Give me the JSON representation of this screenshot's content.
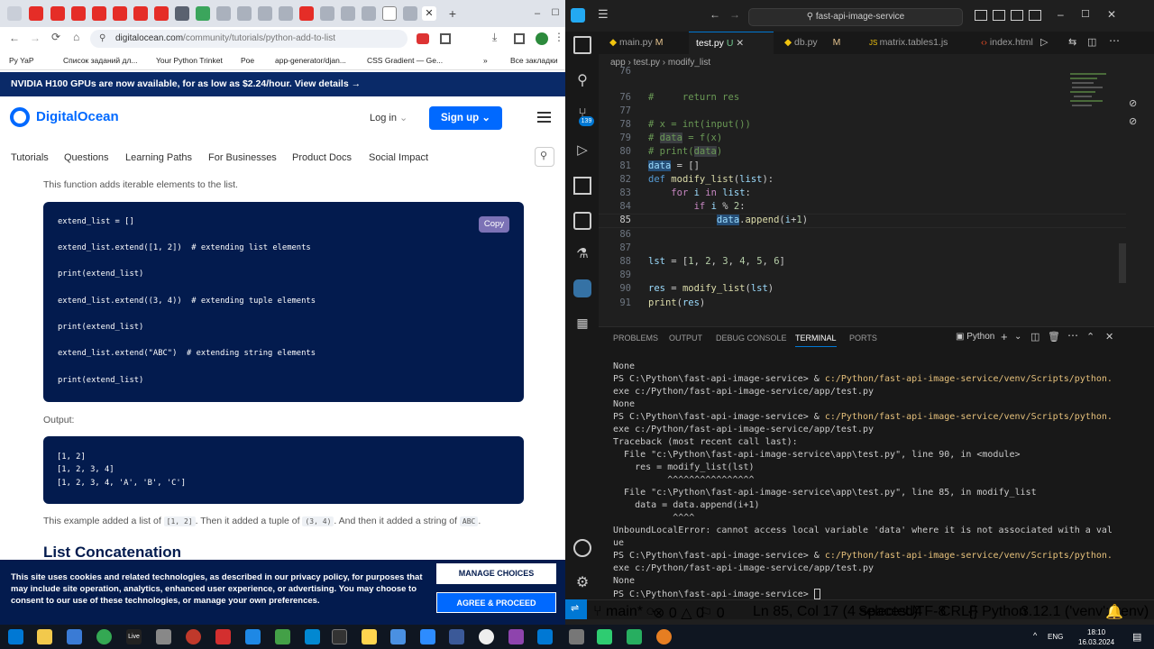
{
  "browser": {
    "url_host": "digitalocean.com",
    "url_path": "/community/tutorials/python-add-to-list",
    "bookmarks": [
      "Py YaP",
      "Список заданий дл...",
      "Your Python Trinket",
      "Poe",
      "app-generator/djan...",
      "CSS Gradient — Ge...",
      "»",
      "Все закладки"
    ],
    "banner": "NVIDIA H100 GPUs are now available, for as low as $2.24/hour. View details →",
    "logo": "DigitalOcean",
    "login": "Log in",
    "signup": "Sign up",
    "subnav": [
      "Tutorials",
      "Questions",
      "Learning Paths",
      "For Businesses",
      "Product Docs",
      "Social Impact"
    ],
    "intro": "This function adds iterable elements to the list.",
    "code_lines": [
      "extend_list = []",
      "extend_list.extend([1, 2])  # extending list elements",
      "print(extend_list)",
      "extend_list.extend((3, 4))  # extending tuple elements",
      "print(extend_list)",
      "extend_list.extend(\"ABC\")  # extending string elements",
      "print(extend_list)"
    ],
    "copy": "Copy",
    "output_label": "Output:",
    "output_lines": [
      "[1, 2]",
      "[1, 2, 3, 4]",
      "[1, 2, 3, 4, 'A', 'B', 'C']"
    ],
    "example_text": {
      "a": "This example added a list of",
      "b": "[1, 2]",
      "c": ". Then it added a tuple of",
      "d": "(3, 4)",
      "e": ". And then it added a string of",
      "f": "ABC",
      "g": "."
    },
    "heading": "List Concatenation",
    "cookie_text": "This site uses cookies and related technologies, as described in our privacy policy, for purposes that may include site operation, analytics, enhanced user experience, or advertising. You may choose to consent to our use of these technologies, or manage your own preferences.",
    "manage_choices": "MANAGE CHOICES",
    "agree": "AGREE & PROCEED"
  },
  "vscode": {
    "search": "fast-api-image-service",
    "tabs": [
      {
        "label": "main.py",
        "badge": "M"
      },
      {
        "label": "test.py",
        "badge": "U"
      },
      {
        "label": "db.py",
        "badge": "M"
      },
      {
        "label": "matrix.tables1.js",
        "badge": ""
      },
      {
        "label": "index.html",
        "badge": ""
      }
    ],
    "breadcrumb": "app  ›  test.py  ›  modify_list",
    "scm_badge": "139",
    "line_numbers": [
      "76",
      "77",
      "78",
      "79",
      "80",
      "81",
      "82",
      "83",
      "84",
      "85",
      "86",
      "87",
      "88",
      "89",
      "90",
      "91"
    ],
    "panel_tabs": [
      "PROBLEMS",
      "OUTPUT",
      "DEBUG CONSOLE",
      "TERMINAL",
      "PORTS"
    ],
    "terminal_profile": "Python",
    "terminal": [
      "None",
      "PS C:\\Python\\fast-api-image-service> & c:/Python/fast-api-image-service/venv/Scripts/python.",
      "exe c:/Python/fast-api-image-service/app/test.py",
      "None",
      "PS C:\\Python\\fast-api-image-service> & c:/Python/fast-api-image-service/venv/Scripts/python.",
      "exe c:/Python/fast-api-image-service/app/test.py",
      "Traceback (most recent call last):",
      "  File \"c:\\Python\\fast-api-image-service\\app\\test.py\", line 90, in <module>",
      "    res = modify_list(lst)",
      "          ^^^^^^^^^^^^^^^^",
      "  File \"c:\\Python\\fast-api-image-service\\app\\test.py\", line 85, in modify_list",
      "    data = data.append(i+1)",
      "           ^^^^",
      "UnboundLocalError: cannot access local variable 'data' where it is not associated with a val",
      "ue",
      "PS C:\\Python\\fast-api-image-service> & c:/Python/fast-api-image-service/venv/Scripts/python.",
      "exe c:/Python/fast-api-image-service/app/test.py",
      "None",
      "PS C:\\Python\\fast-api-image-service> "
    ],
    "status": {
      "branch": "main*",
      "errors": "0",
      "warnings": "0",
      "ports": "0",
      "position": "Ln 85, Col 17 (4 selected)",
      "spaces": "Spaces: 4",
      "encoding": "UTF-8",
      "eol": "CRLF",
      "language": "Python",
      "interpreter": "3.12.1 ('venv': venv)"
    }
  },
  "taskbar": {
    "lang": "ENG",
    "time": "18:10",
    "date": "16.03.2024"
  },
  "colors": {
    "do_blue": "#0069ff",
    "do_navy": "#031b4e",
    "vscode_accent": "#0078d4"
  }
}
